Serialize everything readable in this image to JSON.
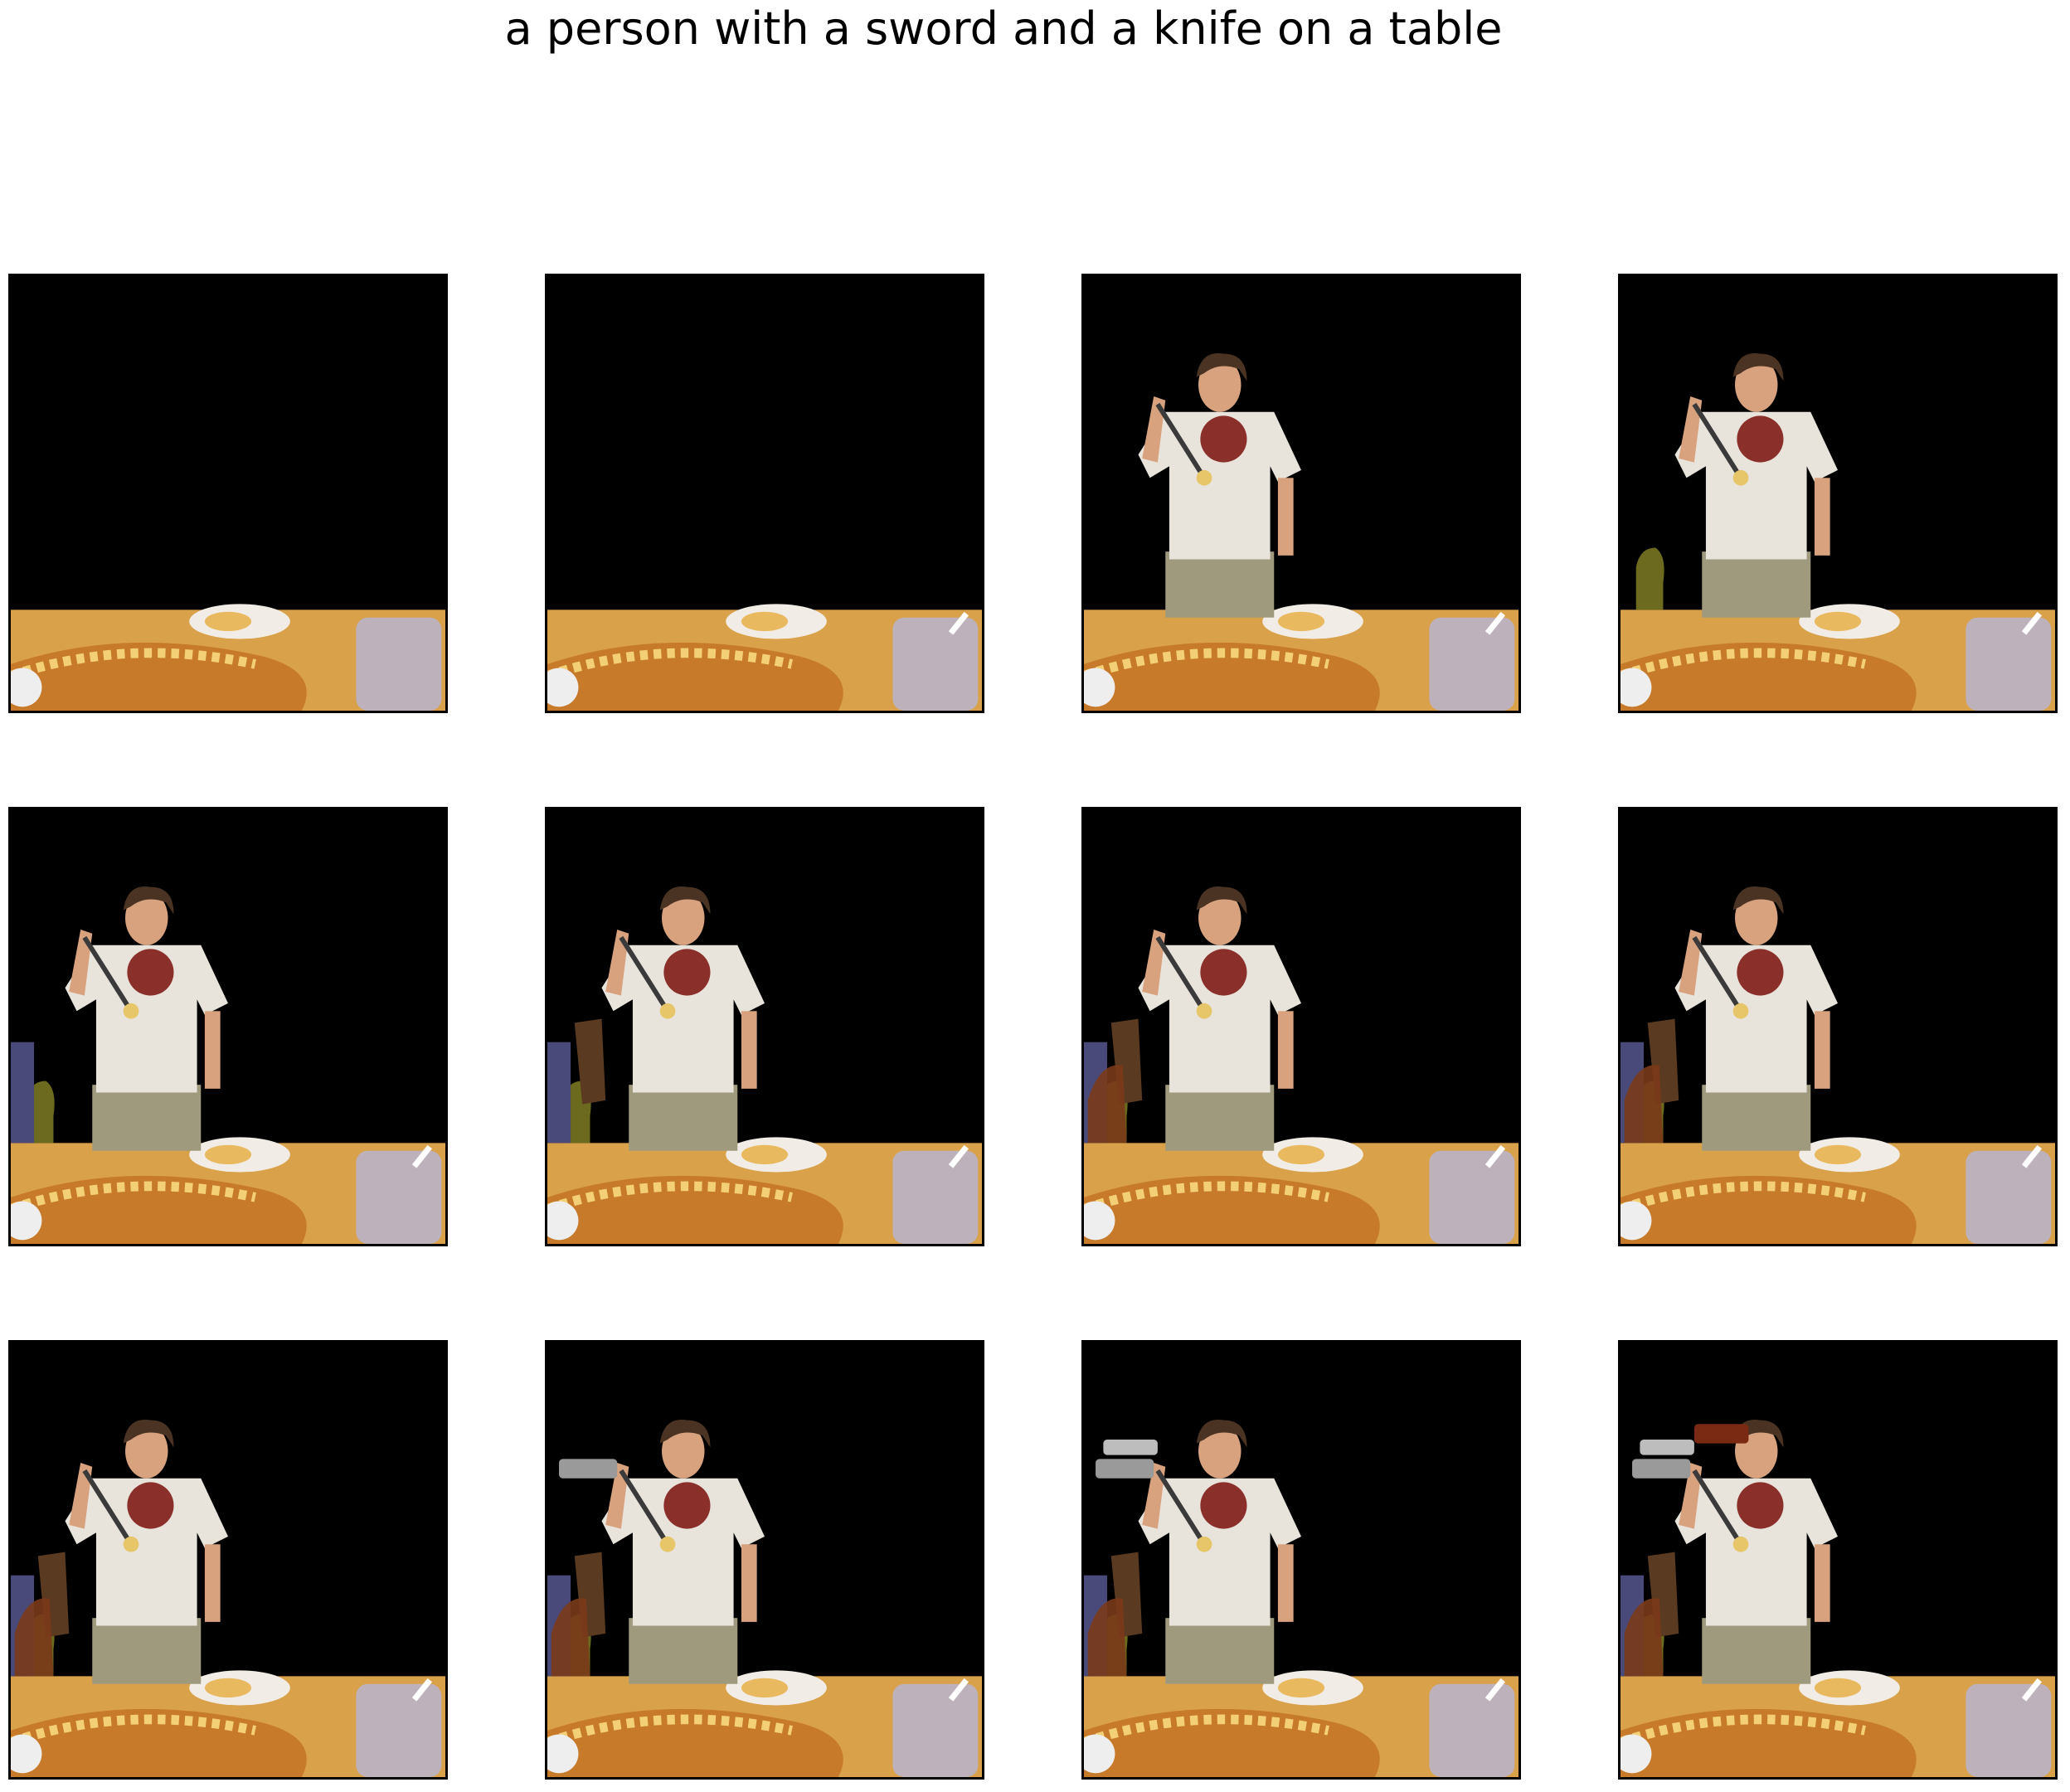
{
  "figure": {
    "title": "a person with a sword and a knife on a table"
  },
  "panels": [
    {
      "name": "step-1",
      "layers": [
        "table"
      ]
    },
    {
      "name": "step-2",
      "layers": [
        "table",
        "cup-handle"
      ]
    },
    {
      "name": "step-3",
      "layers": [
        "table",
        "cup-handle",
        "person"
      ]
    },
    {
      "name": "step-4",
      "layers": [
        "table",
        "cup-handle",
        "person",
        "bottle"
      ]
    },
    {
      "name": "step-5",
      "layers": [
        "table",
        "cup-handle",
        "person",
        "bottle",
        "chair-left"
      ]
    },
    {
      "name": "step-6",
      "layers": [
        "table",
        "cup-handle",
        "person",
        "bottle",
        "chair-left",
        "chair-back"
      ]
    },
    {
      "name": "step-7",
      "layers": [
        "table",
        "cup-handle",
        "person",
        "bottle",
        "chair-left",
        "chair-back",
        "bag"
      ]
    },
    {
      "name": "step-8",
      "layers": [
        "table",
        "cup-handle",
        "person",
        "bottle",
        "chair-left",
        "chair-back",
        "bag"
      ]
    },
    {
      "name": "step-9",
      "layers": [
        "table",
        "cup-handle",
        "person",
        "bottle",
        "chair-left",
        "chair-back",
        "bag"
      ]
    },
    {
      "name": "step-10",
      "layers": [
        "table",
        "cup-handle",
        "person",
        "bottle",
        "chair-left",
        "chair-back",
        "bag",
        "knife"
      ]
    },
    {
      "name": "step-11",
      "layers": [
        "table",
        "cup-handle",
        "person",
        "bottle",
        "chair-left",
        "chair-back",
        "bag",
        "knife",
        "knife-2"
      ]
    },
    {
      "name": "step-12",
      "layers": [
        "table",
        "cup-handle",
        "person",
        "bottle",
        "chair-left",
        "chair-back",
        "bag",
        "knife",
        "knife-2",
        "sword"
      ]
    }
  ],
  "colors": {
    "background": "#000000",
    "table": "#d9a24a",
    "pizza": "#c77a2a",
    "plate": "#f1ede6",
    "cup": "#b9b3c8",
    "shirt": "#e8e4dc",
    "pants": "#9f9a7e",
    "skin": "#d8a27f",
    "hair": "#4a3322",
    "shirt_print": "#8b2f2a",
    "chair": "#5a3a20",
    "knife": "#9a9a9a",
    "sword": "#7a2a12"
  }
}
